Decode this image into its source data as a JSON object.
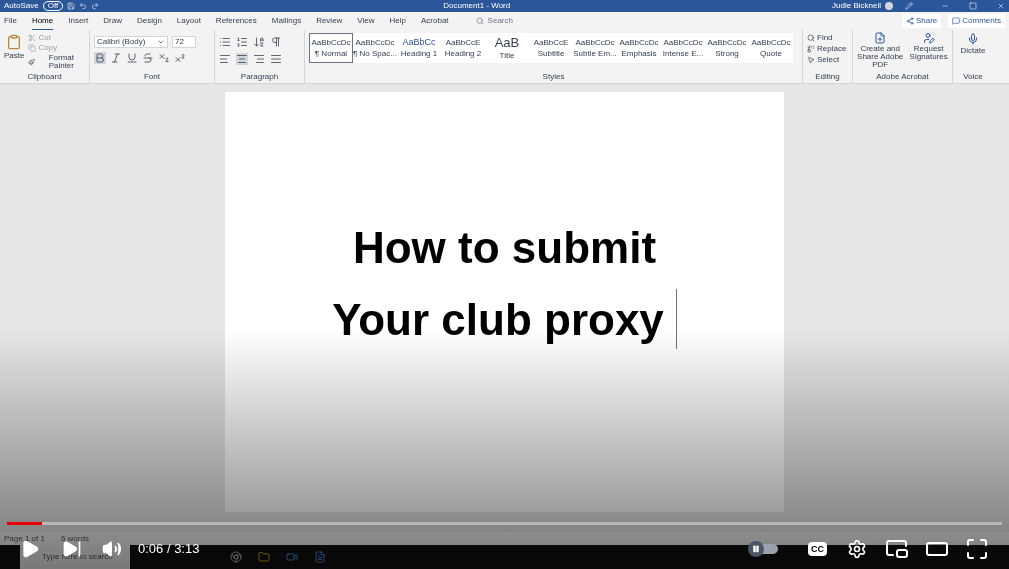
{
  "word": {
    "autosave_label": "AutoSave",
    "autosave_toggle": {
      "label": "Off",
      "on": false
    },
    "title": "Document1 - Word",
    "user": "Judie Bicknell",
    "tabs": [
      {
        "label": "File",
        "selected": false
      },
      {
        "label": "Home",
        "selected": true
      },
      {
        "label": "Insert",
        "selected": false
      },
      {
        "label": "Draw",
        "selected": false
      },
      {
        "label": "Design",
        "selected": false
      },
      {
        "label": "Layout",
        "selected": false
      },
      {
        "label": "References",
        "selected": false
      },
      {
        "label": "Mailings",
        "selected": false
      },
      {
        "label": "Review",
        "selected": false
      },
      {
        "label": "View",
        "selected": false
      },
      {
        "label": "Help",
        "selected": false
      },
      {
        "label": "Acrobat",
        "selected": false
      }
    ],
    "search": {
      "placeholder": "Search"
    },
    "share": "Share",
    "comments": "Comments",
    "clipboard": {
      "paste": "Paste",
      "cut": "Cut",
      "copy": "Copy",
      "format_painter": "Format Painter",
      "label": "Clipboard"
    },
    "font": {
      "name": "Calibri (Body)",
      "size": "72",
      "label": "Font"
    },
    "paragraph": {
      "label": "Paragraph"
    },
    "styles": {
      "items": [
        {
          "preview": "AaBbCcDc",
          "name": "¶ Normal",
          "selected": true
        },
        {
          "preview": "AaBbCcDc",
          "name": "¶ No Spac...",
          "selected": false
        },
        {
          "preview": "AaBbCc",
          "name": "Heading 1",
          "selected": false
        },
        {
          "preview": "AaBbCcE",
          "name": "Heading 2",
          "selected": false
        },
        {
          "preview": "AaB",
          "name": "Title",
          "selected": false
        },
        {
          "preview": "AaBbCcE",
          "name": "Subtitle",
          "selected": false
        },
        {
          "preview": "AaBbCcDc",
          "name": "Subtle Em...",
          "selected": false
        },
        {
          "preview": "AaBbCcDc",
          "name": "Emphasis",
          "selected": false
        },
        {
          "preview": "AaBbCcDc",
          "name": "Intense E...",
          "selected": false
        },
        {
          "preview": "AaBbCcDc",
          "name": "Strong",
          "selected": false
        },
        {
          "preview": "AaBbCcDc",
          "name": "Quote",
          "selected": false
        }
      ],
      "label": "Styles"
    },
    "editing": {
      "find": "Find",
      "replace": "Replace",
      "select": "Select",
      "label": "Editing"
    },
    "acrobat": {
      "create": "Create and Share Adobe PDF",
      "request": "Request Signatures",
      "label": "Adobe Acrobat"
    },
    "voice": {
      "dictate": "Dictate",
      "label": "Voice"
    },
    "document": {
      "lines": [
        "How to submit",
        "Your club proxy"
      ]
    },
    "status_bar": {
      "page": "Page 1 of 1",
      "words": "6 words"
    },
    "taskbar": {
      "search_placeholder": "Type here to search"
    }
  },
  "player": {
    "progress": {
      "level": 0.035
    },
    "time": "0:06 / 3:13",
    "autoplay": {
      "on": false
    },
    "captions": "CC"
  }
}
